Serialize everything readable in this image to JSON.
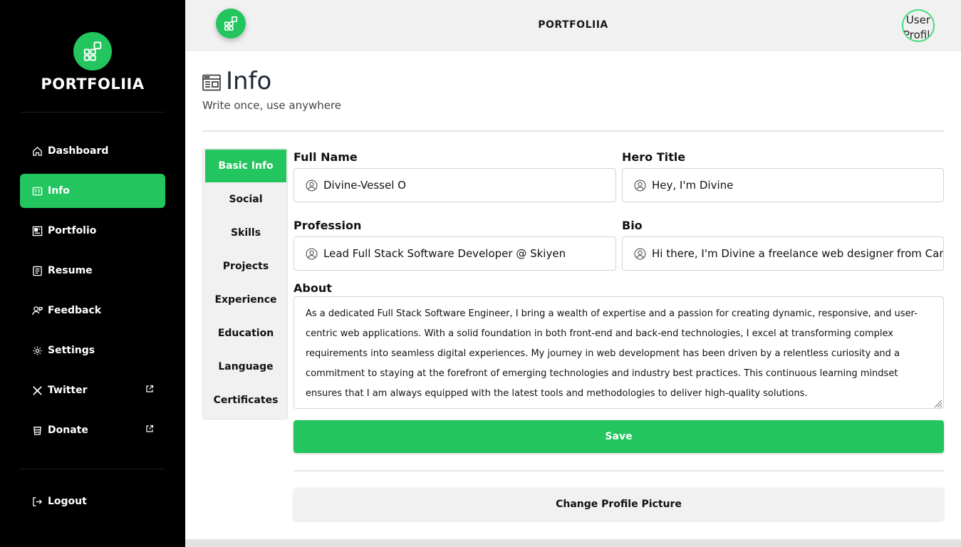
{
  "brand": {
    "name": "PORTFOLIIA",
    "accent": "#22c55e"
  },
  "sidebar": {
    "items": [
      {
        "label": "Dashboard",
        "icon": "home-icon"
      },
      {
        "label": "Info",
        "icon": "info-card-icon",
        "active": true
      },
      {
        "label": "Portfolio",
        "icon": "portfolio-icon"
      },
      {
        "label": "Resume",
        "icon": "document-icon"
      },
      {
        "label": "Feedback",
        "icon": "feedback-icon"
      },
      {
        "label": "Settings",
        "icon": "gear-icon"
      },
      {
        "label": "Twitter",
        "icon": "x-logo-icon",
        "external": true
      },
      {
        "label": "Donate",
        "icon": "cup-icon",
        "external": true
      }
    ],
    "logout_label": "Logout"
  },
  "header": {
    "title": "PORTFOLIIA",
    "avatar_alt": "User Profile"
  },
  "page": {
    "title": "Info",
    "subtitle": "Write once, use anywhere"
  },
  "tabs": [
    "Basic Info",
    "Social",
    "Skills",
    "Projects",
    "Experience",
    "Education",
    "Language",
    "Certificates"
  ],
  "form": {
    "full_name": {
      "label": "Full Name",
      "value": "Divine-Vessel O"
    },
    "hero_title": {
      "label": "Hero Title",
      "value": "Hey, I'm Divine"
    },
    "profession": {
      "label": "Profession",
      "value": "Lead Full Stack Software Developer @ Skiyen"
    },
    "bio": {
      "label": "Bio",
      "value": "Hi there, I'm Divine a freelance web designer from Canada"
    },
    "about": {
      "label": "About",
      "value": "As a dedicated Full Stack Software Engineer, I bring a wealth of expertise and a passion for creating dynamic, responsive, and user-centric web applications. With a solid foundation in both front-end and back-end technologies, I excel at transforming complex requirements into seamless digital experiences. My journey in web development has been driven by a relentless curiosity and a commitment to staying at the forefront of emerging technologies and industry best practices. This continuous learning mindset ensures that I am always equipped with the latest tools and methodologies to deliver high-quality solutions."
    },
    "save_label": "Save",
    "change_picture_label": "Change Profile Picture"
  }
}
